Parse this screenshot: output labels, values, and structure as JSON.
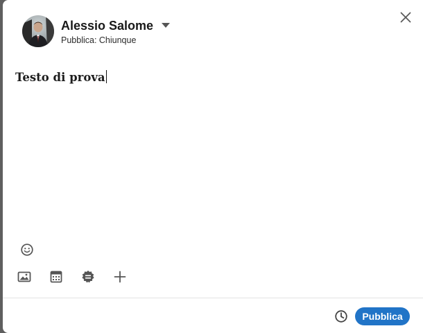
{
  "composer": {
    "author_name": "Alessio Salome",
    "visibility_label": "Pubblica: Chiunque",
    "post_text": "Testo di prova"
  },
  "toolbar": {
    "icons": [
      "emoji-icon",
      "image-icon",
      "calendar-icon",
      "badge-icon",
      "plus-icon"
    ]
  },
  "footer": {
    "schedule_icon": "clock-icon",
    "publish_label": "Pubblica"
  },
  "colors": {
    "accent": "#0a66c2",
    "text_primary": "#191919",
    "icon": "#555555"
  }
}
